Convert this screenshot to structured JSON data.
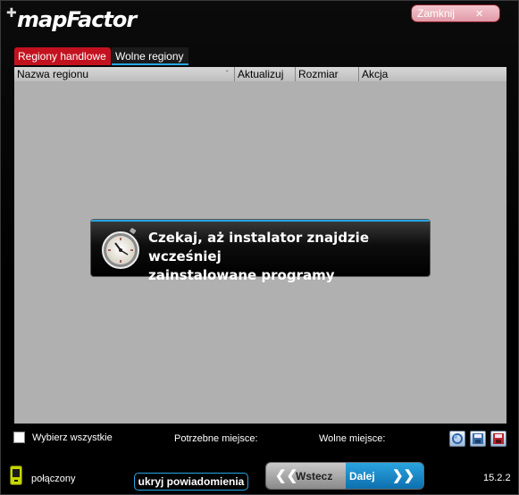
{
  "app": {
    "logo": "mapFactor",
    "version": "15.2.2"
  },
  "header": {
    "close_label": "Zamknij",
    "close_icon": "×"
  },
  "tabs": [
    {
      "label": "Regiony handlowe",
      "active": true
    },
    {
      "label": "Wolne regiony",
      "active": false
    }
  ],
  "table": {
    "columns": [
      "Nazwa regionu",
      "Aktualizuj",
      "Rozmiar",
      "Akcja"
    ],
    "sort_icon": "ˇ",
    "rows": []
  },
  "dialog": {
    "message_line1": "Czekaj, aż instalator znajdzie wcześniej",
    "message_line2": "zainstalowane programy"
  },
  "footer": {
    "select_all_label": "Wybierz wszystkie",
    "select_all_checked": false,
    "needed_space_label": "Potrzebne miejsce:",
    "free_space_label": "Wolne miejsce:",
    "tools": [
      "refresh-icon",
      "save-icon",
      "delete-icon"
    ]
  },
  "status": {
    "connection": "połączony",
    "hide_notifications": "ukryj powiadomienia"
  },
  "navigation": {
    "back_label": "Wstecz",
    "back_arrows": "❮❮",
    "next_label": "Dalej",
    "next_arrows": "❯❯"
  },
  "colors": {
    "accent_red": "#c3121f",
    "accent_blue": "#26a7e4",
    "content_gray": "#b0b0b0"
  }
}
